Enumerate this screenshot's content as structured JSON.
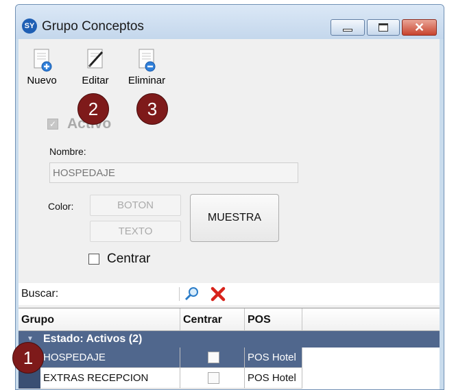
{
  "window": {
    "app_icon": "SY",
    "title": "Grupo Conceptos",
    "controls": {
      "minimize": "minimize-icon",
      "maximize": "maximize-icon",
      "close": "close-icon"
    }
  },
  "toolbar": {
    "nuevo_label": "Nuevo",
    "editar_label": "Editar",
    "eliminar_label": "Eliminar"
  },
  "badges": {
    "one": "1",
    "two": "2",
    "three": "3",
    "color": "#7e1a1a"
  },
  "form": {
    "activo_label": "Activo",
    "nombre_label": "Nombre:",
    "nombre_value": "HOSPEDAJE",
    "color_label": "Color:",
    "boton_label": "BOTON",
    "texto_label": "TEXTO",
    "muestra_label": "MUESTRA",
    "centrar_label": "Centrar"
  },
  "search": {
    "label": "Buscar:",
    "value": "",
    "search_icon": "magnifier-icon",
    "clear_icon": "red-x-icon"
  },
  "grid": {
    "columns": [
      "Grupo",
      "Centrar",
      "POS"
    ],
    "group_header": "Estado: Activos (2)",
    "rows": [
      {
        "grupo": "HOSPEDAJE",
        "centrar": false,
        "pos": "POS Hotel",
        "selected": true
      },
      {
        "grupo": "EXTRAS RECEPCION",
        "centrar": false,
        "pos": "POS Hotel",
        "selected": false
      }
    ],
    "selection_color": "#50678d"
  }
}
